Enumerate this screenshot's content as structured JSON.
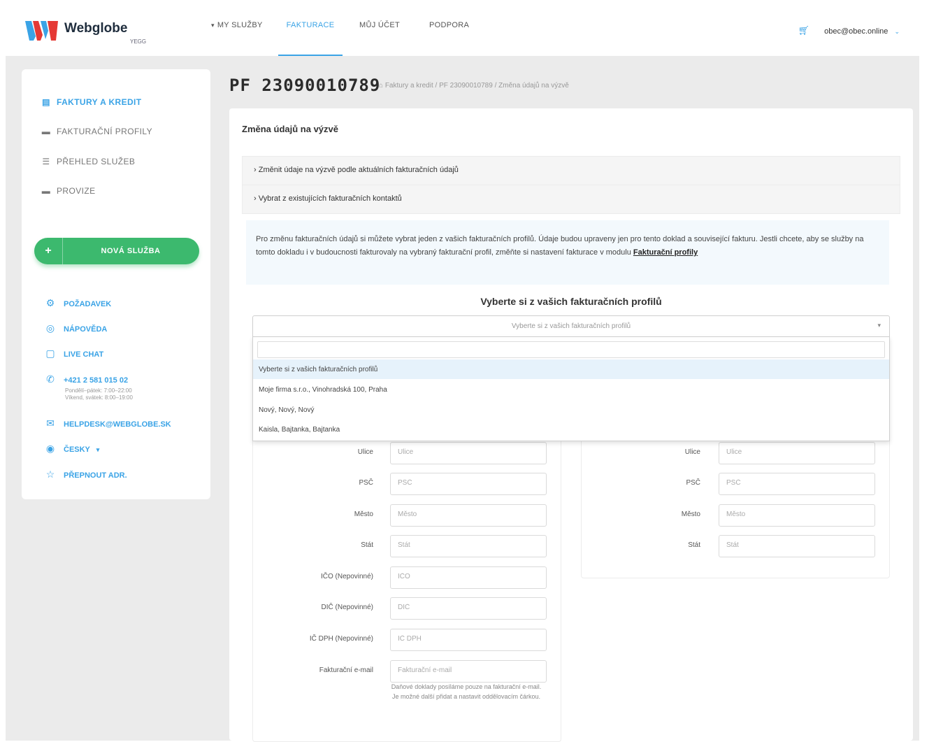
{
  "brand": {
    "name": "Webglobe",
    "sub": "YEGG",
    "colors": {
      "blue": "#3aa3e6",
      "red": "#e53935",
      "green": "#3cb96e"
    }
  },
  "nav": {
    "items": [
      {
        "label": "MY SLUŽBY",
        "caret": "▾"
      },
      {
        "label": "FAKTURACE",
        "active": true
      },
      {
        "label": "MŮJ ÚČET"
      },
      {
        "label": "PODPORA"
      }
    ]
  },
  "user": {
    "cart_icon": "cart-icon",
    "email": "obec@obec.online",
    "chevron": "⌄"
  },
  "sidebar": {
    "items": [
      {
        "label": "FAKTURY A KREDIT",
        "icon": "invoice-icon",
        "active": true
      },
      {
        "label": "FAKTURAČNÍ PROFILY",
        "icon": "profile-icon"
      },
      {
        "label": "PŘEHLED SLUŽEB",
        "icon": "list-icon"
      },
      {
        "label": "PROVIZE",
        "icon": "wallet-icon"
      }
    ],
    "new_service": {
      "plus": "+",
      "label": "NOVÁ SLUŽBA"
    },
    "contacts": [
      {
        "label": "POŽADAVEK",
        "icon": "request-icon"
      },
      {
        "label": "NÁPOVĚDA",
        "icon": "help-icon"
      },
      {
        "label": "LIVE CHAT",
        "icon": "chat-icon"
      },
      {
        "label": "+421 2 581 015 02",
        "icon": "phone-icon",
        "note1": "Pondělí–pátek: 7:00–22:00",
        "note2": "Víkend, svátek: 8:00–19:00"
      },
      {
        "label": "HELPDESK@WEBGLOBE.SK",
        "icon": "mail-icon"
      },
      {
        "label": "ČESKY",
        "icon": "globe-icon",
        "chevron": "▾"
      },
      {
        "label": "PŘEPNOUT ADR.",
        "icon": "switch-icon"
      }
    ]
  },
  "page": {
    "title": "PF 23090010789",
    "breadcrumb": "Faktury a kredit / PF 23090010789 / Změna údajů na výzvě"
  },
  "card": {
    "title": "Změna údajů na výzvě",
    "accordion": [
      "› Změnit údaje na výzvě podle aktuálních fakturačních údajů",
      "› Vybrat z existujících fakturačních kontaktů"
    ],
    "info_text": "Pro změnu fakturačních údajů si můžete vybrat jeden z vašich fakturačních profilů. Údaje budou upraveny jen pro tento doklad a související fakturu. Jestli chcete, aby se služby na tomto dokladu i v budoucnosti fakturovaly na vybraný fakturační profil, změňte si nastavení fakturace v modulu",
    "info_link": "Fakturační profily",
    "pick_title": "Vyberte si z vašich fakturačních profilů",
    "select": {
      "value": "Vyberte si z vašich fakturačních profilů",
      "options": [
        "Vyberte si z vašich fakturačních profilů",
        "Moje firma s.r.o., Vinohradská 100, Praha",
        "Nový, Nový, Nový",
        "Kaisla, Bajtanka, Bajtanka"
      ]
    },
    "left_fields": [
      {
        "label": "Ulice",
        "placeholder": "Ulice"
      },
      {
        "label": "PSČ",
        "placeholder": "PSČ"
      },
      {
        "label": "Město",
        "placeholder": "Město"
      },
      {
        "label": "Stát",
        "placeholder": "Stát"
      },
      {
        "label": "IČO (Nepovinné)",
        "placeholder": "IČO"
      },
      {
        "label": "DIČ (Nepovinné)",
        "placeholder": "DIČ"
      },
      {
        "label": "IČ DPH (Nepovinné)",
        "placeholder": "IČ DPH"
      },
      {
        "label": "Fakturační e-mail",
        "placeholder": "Fakturační e-mail"
      }
    ],
    "right_fields": [
      {
        "label": "Ulice",
        "placeholder": "Ulice"
      },
      {
        "label": "PSČ",
        "placeholder": "PSČ"
      },
      {
        "label": "Město",
        "placeholder": "Město"
      },
      {
        "label": "Stát",
        "placeholder": "Stát"
      }
    ],
    "hint": "Daňové doklady posíláme pouze na fakturační e-mail. Je možné další přidat a nastavit oddělovacím čárkou."
  }
}
